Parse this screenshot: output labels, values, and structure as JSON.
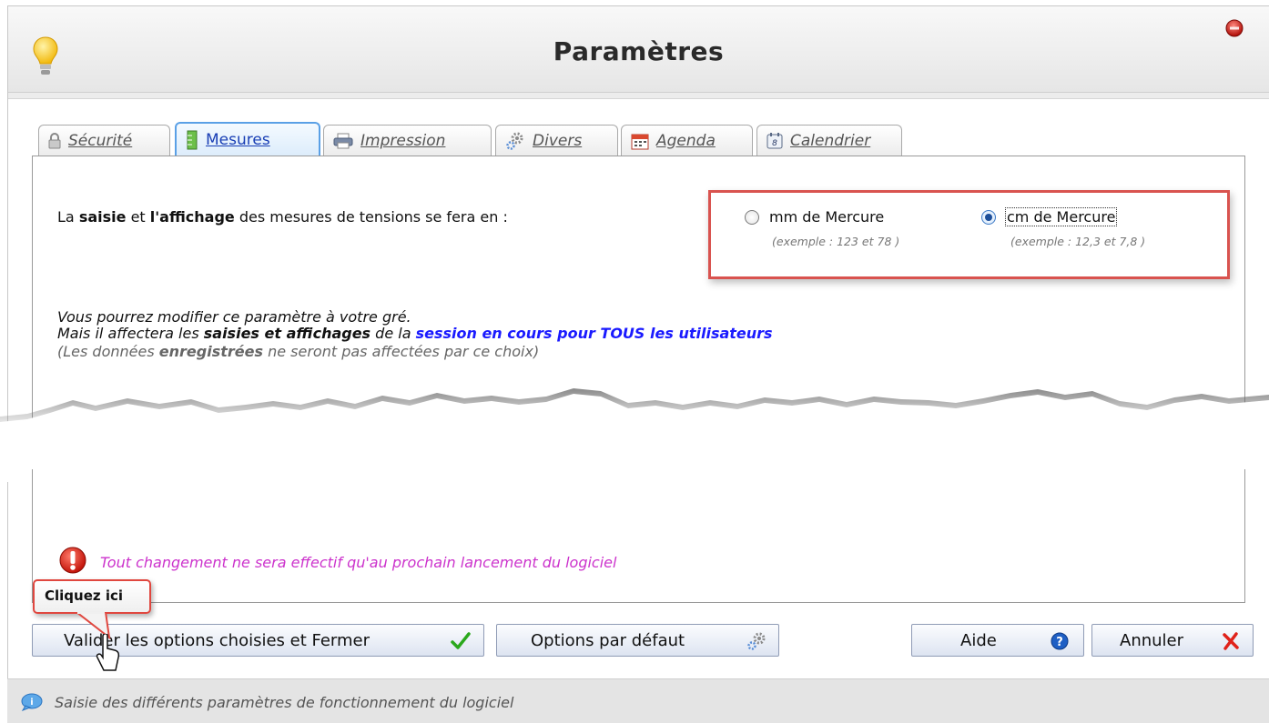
{
  "window": {
    "title": "Paramètres"
  },
  "tabs": [
    {
      "label": "Sécurité",
      "icon": "lock-icon"
    },
    {
      "label": "Mesures",
      "icon": "ruler-icon"
    },
    {
      "label": "Impression",
      "icon": "printer-icon"
    },
    {
      "label": "Divers",
      "icon": "gears-icon"
    },
    {
      "label": "Agenda",
      "icon": "calendar-icon"
    },
    {
      "label": "Calendrier",
      "icon": "calendar-flip-icon"
    }
  ],
  "active_tab": "Mesures",
  "main": {
    "intro": {
      "p1": "La ",
      "b1": "saisie",
      "p2": " et ",
      "b2": "l'affichage",
      "p3": " des mesures de tensions se fera en :"
    },
    "options": [
      {
        "label": "mm de Mercure",
        "example": "(exemple :  123  et 78 )",
        "selected": false
      },
      {
        "label": "cm de Mercure",
        "example": "(exemple :  12,3  et 7,8 )",
        "selected": true
      }
    ],
    "note1": "Vous pourrez modifier ce paramètre à votre gré.",
    "note2": {
      "p1": "Mais il affectera les ",
      "b1": "saisies et affichages",
      "p2": " de la ",
      "b2": "session en cours pour TOUS les utilisateurs"
    },
    "note3": {
      "p1": "(Les données ",
      "b1": "enregistrées",
      "p2": " ne seront pas affectées par ce choix)"
    },
    "warning": "Tout changement ne sera effectif qu'au prochain lancement du logiciel"
  },
  "callout": "Cliquez ici",
  "buttons": {
    "validate": "Valider les options choisies et Fermer",
    "defaults": "Options par défaut",
    "help": "Aide",
    "cancel": "Annuler"
  },
  "status": "Saisie des différents paramètres de fonctionnement du logiciel",
  "colors": {
    "accent_link": "#1a1aff",
    "warning_text": "#cc33cc",
    "callout_border": "#e0473f",
    "highlight_box": "#d9534f"
  }
}
